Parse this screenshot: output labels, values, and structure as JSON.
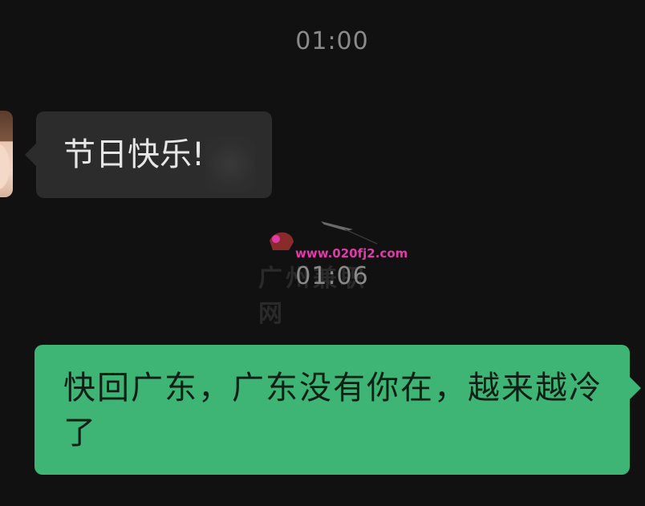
{
  "chat": {
    "timestamps": [
      "01:00",
      "01:06"
    ],
    "incoming": {
      "text": "节日快乐!"
    },
    "outgoing": {
      "text": "快回广东，广东没有你在，越来越冷了"
    }
  },
  "watermark": {
    "url": "www.020fj2.com",
    "site_name": "广州兼职网"
  },
  "colors": {
    "background": "#111111",
    "incoming_bubble": "#2c2c2c",
    "outgoing_bubble": "#3eb575",
    "timestamp_text": "#8a8a8a"
  },
  "icons": {
    "avatar": "contact-avatar",
    "watermark_logo": "airplane-logo-icon"
  }
}
